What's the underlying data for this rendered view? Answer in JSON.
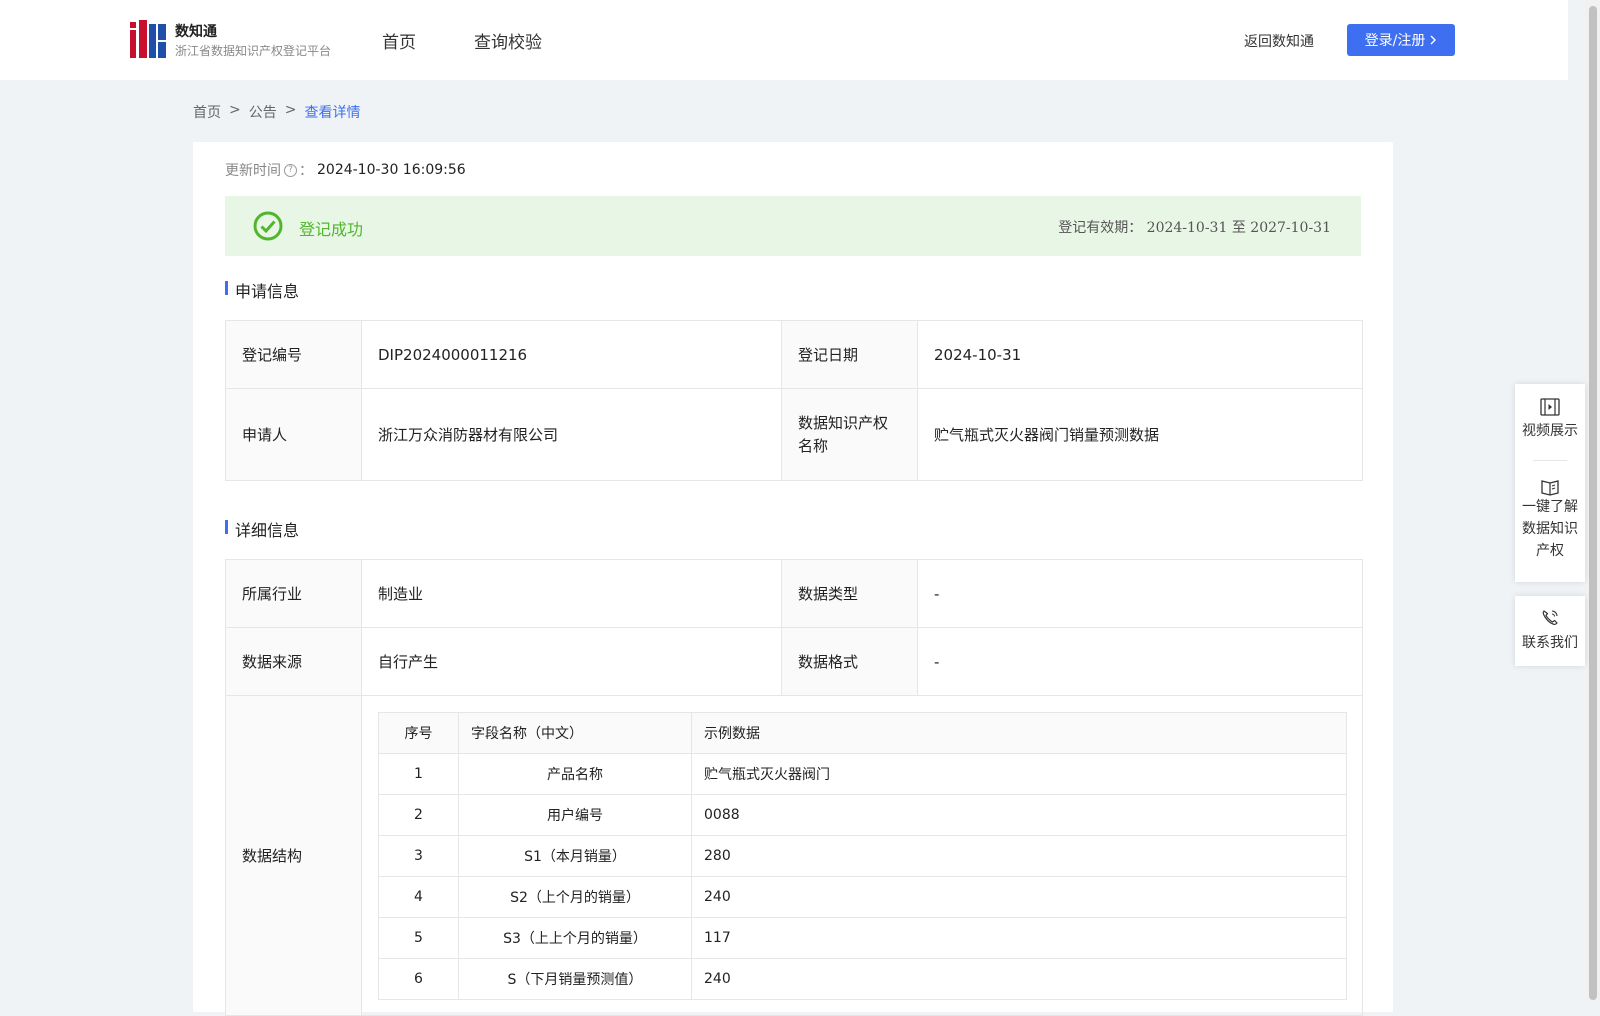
{
  "header": {
    "brand_name": "数知通",
    "brand_subtitle": "浙江省数据知识产权登记平台",
    "nav": [
      "首页",
      "查询校验"
    ],
    "back_link": "返回数知通",
    "login_button": "登录/注册"
  },
  "breadcrumb": [
    "首页",
    ">",
    "公告",
    ">",
    "查看详情"
  ],
  "update": {
    "label": "更新时间",
    "separator": "：",
    "value": "2024-10-30 16:09:56"
  },
  "status": {
    "text": "登记成功",
    "valid_label": "登记有效期：",
    "valid_from": "2024-10-31",
    "valid_to_word": "至",
    "valid_to": "2027-10-31",
    "color": "#52b52e"
  },
  "sections": {
    "application": "申请信息",
    "details": "详细信息"
  },
  "application": {
    "reg_no_label": "登记编号",
    "reg_no": "DIP2024000011216",
    "reg_date_label": "登记日期",
    "reg_date": "2024-10-31",
    "applicant_label": "申请人",
    "applicant": "浙江万众消防器材有限公司",
    "ip_name_label": "数据知识产权名称",
    "ip_name": "贮气瓶式灭火器阀门销量预测数据"
  },
  "details": {
    "industry_label": "所属行业",
    "industry": "制造业",
    "data_type_label": "数据类型",
    "data_type": "-",
    "source_label": "数据来源",
    "source": "自行产生",
    "format_label": "数据格式",
    "format": "-",
    "structure_label": "数据结构"
  },
  "structure_table": {
    "headers": [
      "序号",
      "字段名称（中文）",
      "示例数据"
    ],
    "rows": [
      [
        "1",
        "产品名称",
        "贮气瓶式灭火器阀门"
      ],
      [
        "2",
        "用户编号",
        "0088"
      ],
      [
        "3",
        "S1（本月销量）",
        "280"
      ],
      [
        "4",
        "S2（上个月的销量）",
        "240"
      ],
      [
        "5",
        "S3（上上个月的销量）",
        "117"
      ],
      [
        "6",
        "S（下月销量预测值）",
        "240"
      ]
    ]
  },
  "side_panel": {
    "video": "视频展示",
    "learn": [
      "一键了解",
      "数据知识",
      "产权"
    ],
    "contact": "联系我们"
  },
  "colors": {
    "accent": "#3d6ff0",
    "success_bg": "#e8f7e5",
    "page_bg": "#eff3f6"
  }
}
